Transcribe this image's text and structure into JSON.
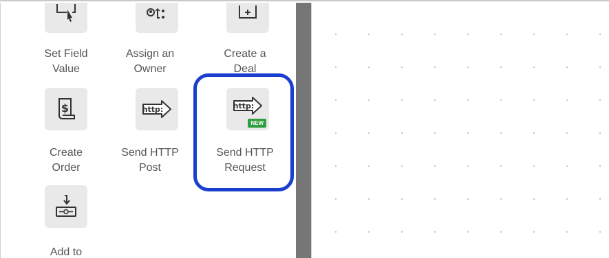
{
  "actions": [
    {
      "id": "set-field-value",
      "label_line1": "Set Field",
      "label_line2": "Value",
      "icon": "cursor-box-icon"
    },
    {
      "id": "assign-owner",
      "label_line1": "Assign an",
      "label_line2": "Owner",
      "icon": "assign-users-icon"
    },
    {
      "id": "create-deal",
      "label_line1": "Create a",
      "label_line2": "Deal",
      "icon": "add-box-icon"
    },
    {
      "id": "create-order",
      "label_line1": "Create",
      "label_line2": "Order",
      "icon": "dollar-scroll-icon"
    },
    {
      "id": "send-http-post",
      "label_line1": "Send HTTP",
      "label_line2": "Post",
      "icon": "http-arrow-icon",
      "icon_text": "http:"
    },
    {
      "id": "send-http-request",
      "label_line1": "Send HTTP",
      "label_line2": "Request",
      "icon": "http-arrow-icon",
      "icon_text": "http:",
      "badge": "NEW"
    },
    {
      "id": "add-to",
      "label_line1": "Add to",
      "label_line2": "",
      "icon": "sequence-add-icon"
    }
  ],
  "colors": {
    "highlight": "#1a3fcf",
    "badge": "#2e9e3e",
    "splitter": "#767676"
  }
}
